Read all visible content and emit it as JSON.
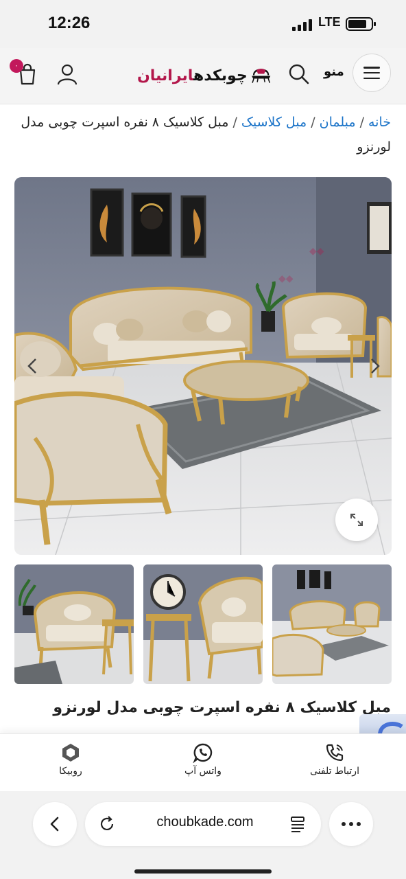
{
  "status_bar": {
    "time": "12:26",
    "network": "LTE"
  },
  "header": {
    "cart_count": "۰",
    "logo_text_a": "چوبکده",
    "logo_text_b": "ایرانیان",
    "menu_label": "منو"
  },
  "breadcrumb": {
    "items": [
      "خانه",
      "مبلمان",
      "مبل کلاسیک"
    ],
    "separator": "/",
    "current": "مبل کلاسیک ۸ نفره اسپرت چوبی مدل لورنزو"
  },
  "product": {
    "title": "مبل کلاسیک ۸ نفره اسپرت چوبی مدل لورنزو",
    "image_alt": "sofa-set-living-room-photo"
  },
  "contact_bar": {
    "phone_label": "ارتباط تلفنی",
    "whatsapp_label": "واتس آپ",
    "rubika_label": "روبیکا"
  },
  "browser": {
    "url": "choubkade.com"
  },
  "colors": {
    "brand": "#b3174b",
    "link": "#1a73c8",
    "gold": "#c9a14a"
  }
}
